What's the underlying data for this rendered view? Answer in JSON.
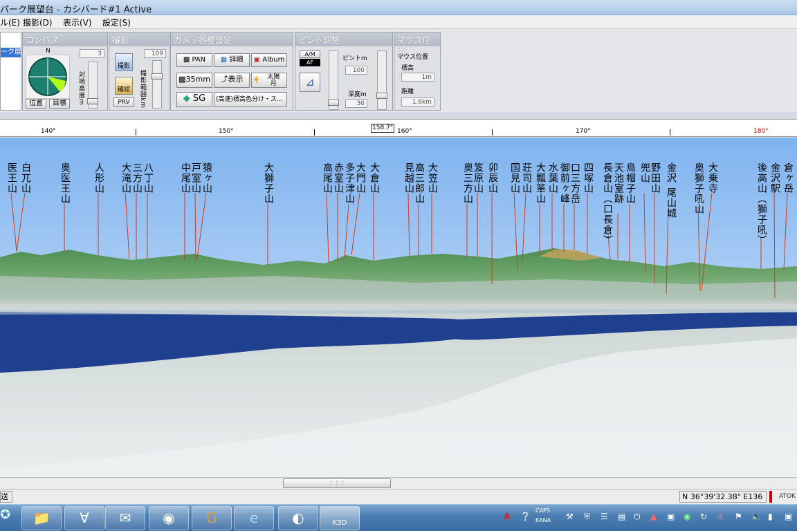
{
  "window": {
    "title": "パーク展望台 - カシバード#1 Active"
  },
  "menu": [
    "ル(E)",
    "撮影(D)",
    "表示(V)",
    "設定(S)"
  ],
  "left_list": {
    "selected_item": "ーク展"
  },
  "compass": {
    "title": "コンパス",
    "north_label": "N",
    "height_value": "3",
    "height_label": "対地高度m",
    "position_button": "位置",
    "target_button": "目標"
  },
  "shooting": {
    "title": "撮影",
    "shoot_button": "撮影",
    "confirm_button": "確認",
    "prv_button": "PRV",
    "range_value": "109",
    "range_label": "撮影範囲km"
  },
  "camera": {
    "title": "カメラ各種設定",
    "pan_button": "PAN",
    "detail_button": "詳細",
    "album_button": "Album",
    "focal_button": "35mm",
    "display_button": "表示",
    "sun_moon_button": "太陽\n月",
    "sg_button": "SG",
    "color_mode_button": "(高速)標高色分け・ス..."
  },
  "focus": {
    "title": "ピント調整",
    "am_label": "A/M",
    "af_label": "AF",
    "pint_label": "ピントm",
    "pint_value": "100",
    "depth_label": "深度m",
    "depth_value": "30"
  },
  "mouse": {
    "title": "マウス位置",
    "heading": "マウス位置",
    "elevation_label": "標高",
    "elevation_value": "1m",
    "distance_label": "距離",
    "distance_value": "1.6km"
  },
  "ruler": {
    "labels": [
      "140°",
      "150°",
      "160°",
      "170°",
      "180°"
    ],
    "highlight_color": "#c00000",
    "marker": "158.7°"
  },
  "mountains": [
    {
      "text": "医王山"
    },
    {
      "text": "白兀山"
    },
    {
      "text": "奥医王山"
    },
    {
      "text": "人形山"
    },
    {
      "text": "大滝山"
    },
    {
      "text": "三方山"
    },
    {
      "text": "八丁山"
    },
    {
      "text": "中尾山"
    },
    {
      "text": "戸室山"
    },
    {
      "text": "猿ヶ山"
    },
    {
      "text": "大獅子山"
    },
    {
      "text": "高尾山"
    },
    {
      "text": "赤室山"
    },
    {
      "text": "多子津山"
    },
    {
      "text": "大門山"
    },
    {
      "text": "大倉山"
    },
    {
      "text": "見越山"
    },
    {
      "text": "高三郎山"
    },
    {
      "text": "大笠山"
    },
    {
      "text": "奥三方山"
    },
    {
      "text": "笈原山"
    },
    {
      "text": "卯辰山"
    },
    {
      "text": "国見山"
    },
    {
      "text": "荘司山"
    },
    {
      "text": "大瓢箪山"
    },
    {
      "text": "水葉山"
    },
    {
      "text": "御前ヶ峰"
    },
    {
      "text": "口三方岳"
    },
    {
      "text": "四塚山"
    },
    {
      "text": "長倉山（口長倉）"
    },
    {
      "text": "天池室跡"
    },
    {
      "text": "烏帽子山"
    },
    {
      "text": "兜山"
    },
    {
      "text": "野田山"
    },
    {
      "text": "金沢"
    },
    {
      "text": "尾山城"
    },
    {
      "text": "奥獅子吼山"
    },
    {
      "text": "大乗寺"
    },
    {
      "text": "後高山（獅子吼）"
    },
    {
      "text": "金沢駅"
    },
    {
      "text": "倉ヶ岳"
    }
  ],
  "status": {
    "left_text": "送る",
    "coords": "N 36°39'32.38\" E136",
    "right_text": "ATOK"
  },
  "taskbar": {
    "apps": [
      "explorer-icon",
      "app-icon",
      "mail-icon",
      "firefox-icon",
      "g-icon",
      "ie-icon",
      "globe-icon",
      "k3d-icon"
    ],
    "k3d_label": "K3D",
    "caps": "CAPS",
    "kana": "KANA"
  }
}
